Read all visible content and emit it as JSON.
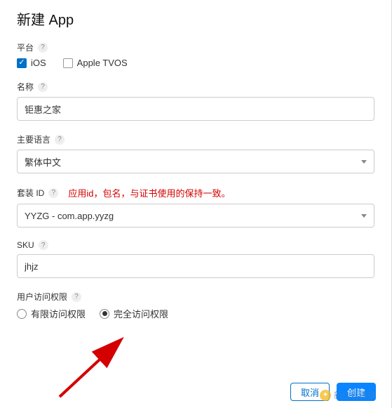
{
  "title": "新建 App",
  "platform": {
    "label": "平台",
    "ios_label": "iOS",
    "tvos_label": "Apple TVOS",
    "ios_checked": true,
    "tvos_checked": false
  },
  "name": {
    "label": "名称",
    "value": "钜惠之家"
  },
  "language": {
    "label": "主要语言",
    "value": "繁体中文"
  },
  "bundle": {
    "label": "套装 ID",
    "annotation": "应用id，包名，与证书使用的保持一致。",
    "value": "YYZG - com.app.yyzg"
  },
  "sku": {
    "label": "SKU",
    "value": "jhjz"
  },
  "access": {
    "label": "用户访问权限",
    "limited_label": "有限访问权限",
    "full_label": "完全访问权限",
    "selected": "full"
  },
  "footer": {
    "cancel": "取消",
    "create": "创建"
  },
  "watermark": "新山新建扶"
}
